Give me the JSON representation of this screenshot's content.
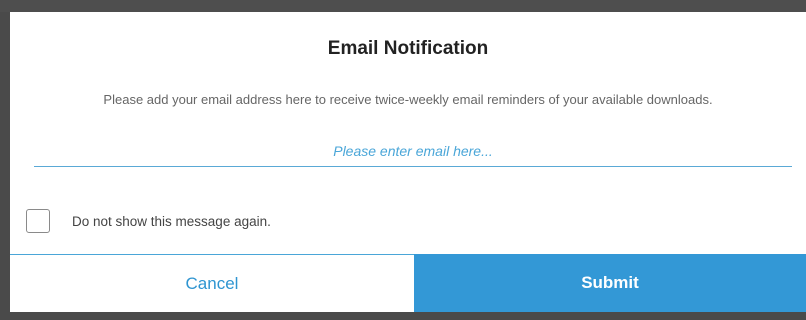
{
  "dialog": {
    "title": "Email Notification",
    "message": "Please add your email address here to receive twice-weekly email reminders of your available downloads.",
    "email_field": {
      "value": "",
      "placeholder": "Please enter email here..."
    },
    "dont_show_again": {
      "label": "Do not show this message again.",
      "checked": false
    },
    "buttons": {
      "cancel_label": "Cancel",
      "submit_label": "Submit"
    }
  },
  "colors": {
    "accent": "#3398d6",
    "link_text": "#2f95d1",
    "backdrop": "#4a4a4a"
  }
}
